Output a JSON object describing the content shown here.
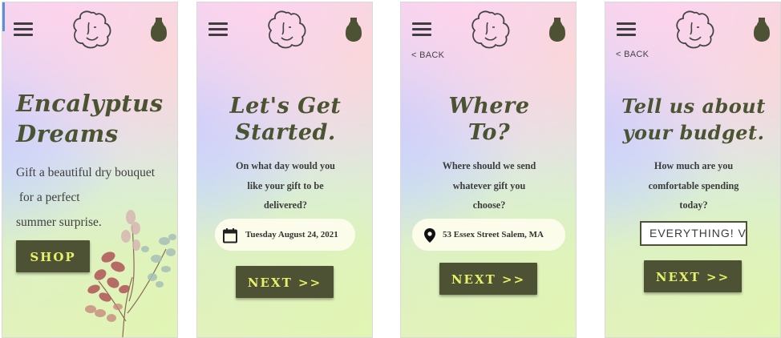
{
  "screens": [
    {
      "id": "home",
      "title": "Encalyptus\nDreams",
      "subtitle_lines": [
        "Gift a beautiful dry bouquet",
        " for a perfect",
        "summer surprise."
      ],
      "button": "SHOP"
    },
    {
      "id": "date",
      "title": "Let's Get\nStarted.",
      "question_lines": [
        "On what day would you",
        "like your gift to be",
        "delivered?"
      ],
      "field_value": "Tuesday August 24, 2021",
      "field_icon": "calendar-icon",
      "button": "NEXT >>"
    },
    {
      "id": "address",
      "back": "< BACK",
      "title": "Where\nTo?",
      "question_lines": [
        "Where should we send",
        "whatever gift you",
        "choose?"
      ],
      "field_value": "53 Essex Street Salem, MA",
      "field_icon": "location-pin-icon",
      "button": "NEXT >>"
    },
    {
      "id": "budget",
      "back": "< BACK",
      "title": "Tell us about\nyour budget.",
      "question_lines": [
        "How much are you",
        "comfortable spending",
        "today?"
      ],
      "field_value": "EVERYTHING! V",
      "button": "NEXT >>"
    }
  ],
  "colors": {
    "primary": "#4c5233",
    "button_text": "#e7f16a",
    "heading": "#4b5430",
    "pill": "#fbfdea"
  }
}
